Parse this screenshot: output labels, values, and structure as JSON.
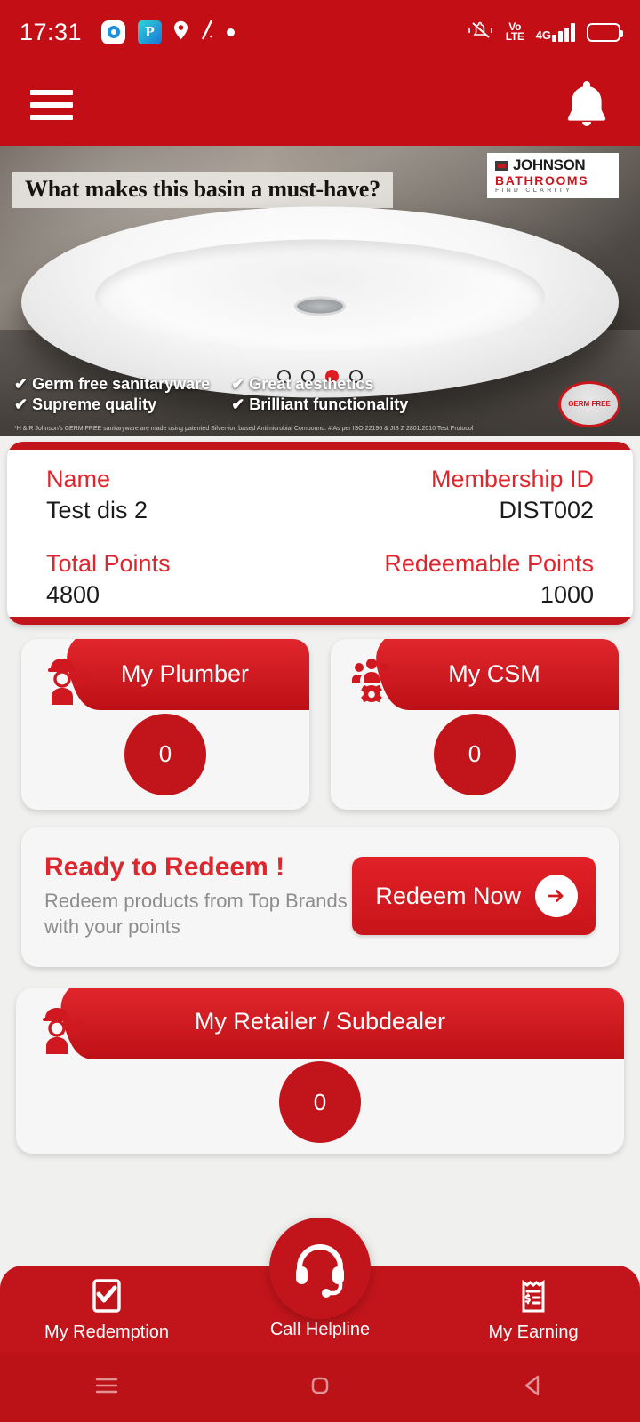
{
  "status_bar": {
    "time": "17:31",
    "left_icons": [
      "media-app-icon",
      "payment-app-icon",
      "location-pin-icon",
      "slash-icon",
      "dot-icon"
    ],
    "right_icons": [
      "silent-mode-icon",
      "volte-icon",
      "signal-4g-icon",
      "battery-icon"
    ],
    "volte_top": "Vo",
    "volte_bottom": "LTE",
    "network": "4G"
  },
  "app_bar": {
    "menu_icon": "hamburger-menu-icon",
    "notification_icon": "bell-icon"
  },
  "banner": {
    "headline": "What makes this basin a must-have?",
    "logo_brand": "JOHNSON",
    "logo_sub": "BATHROOMS",
    "logo_tag": "FIND CLARITY",
    "features_left": [
      "Germ free sanitaryware",
      "Supreme quality"
    ],
    "features_right": [
      "Great aesthetics",
      "Brilliant functionality"
    ],
    "check_mark": "✔",
    "disclaimer": "*H & R Johnson's GERM FREE sanitaryware are made using patented Silver-ion based Antimicrobial Compound. # As per ISO 22196 & JIS Z 2801:2010 Test Protocol",
    "seal_text": "GERM FREE",
    "dots_total": 4,
    "dots_active_index": 2
  },
  "info_card": {
    "rows": [
      {
        "left_label": "Name",
        "left_value": "Test dis 2",
        "right_label": "Membership ID",
        "right_value": "DIST002"
      },
      {
        "left_label": "Total Points",
        "left_value": "4800",
        "right_label": "Redeemable Points",
        "right_value": "1000"
      }
    ]
  },
  "tiles": [
    {
      "title": "My Plumber",
      "count": "0",
      "icon": "plumber-worker-icon"
    },
    {
      "title": "My CSM",
      "count": "0",
      "icon": "team-gear-icon"
    }
  ],
  "redeem": {
    "title": "Ready to Redeem !",
    "subtitle": "Redeem products from Top Brands with your points",
    "button_label": "Redeem Now",
    "button_icon": "arrow-right-icon"
  },
  "retailer_tile": {
    "title": "My Retailer / Subdealer",
    "count": "0",
    "icon": "retailer-worker-icon"
  },
  "bottom_nav": {
    "items": [
      {
        "label": "My Redemption",
        "icon": "checklist-icon"
      },
      {
        "label": "Call Helpline",
        "icon": "headset-icon"
      },
      {
        "label": "My Earning",
        "icon": "receipt-dollar-icon"
      }
    ]
  },
  "system_nav": {
    "icons": [
      "recent-apps-icon",
      "home-icon",
      "back-icon"
    ]
  },
  "colors": {
    "brand_red_dark": "#c20e14",
    "brand_red": "#c2151b",
    "accent_red": "#e0262c",
    "page_bg": "#f0f0ef",
    "card_bg": "#f7f6f6"
  }
}
